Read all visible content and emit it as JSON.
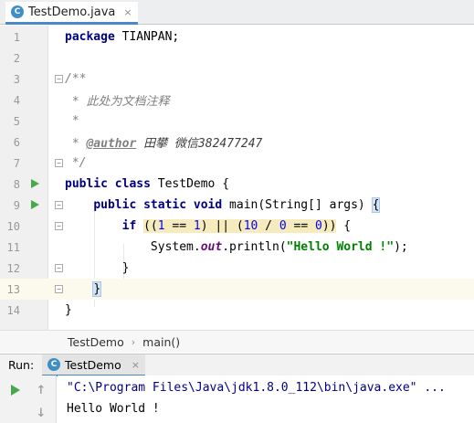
{
  "editor_tab": {
    "filename": "TestDemo.java",
    "icon": "java-class-icon",
    "close_glyph": "×"
  },
  "colors": {
    "keyword": "#000080",
    "comment": "#808080",
    "number": "#0000ff",
    "string": "#008000",
    "static_field": "#660e7a",
    "run_icon": "#49a848",
    "tab_underline": "#4a88c7",
    "current_line": "#fcfaed"
  },
  "code": {
    "line_numbers": [
      "1",
      "2",
      "3",
      "4",
      "5",
      "6",
      "7",
      "8",
      "9",
      "10",
      "11",
      "12",
      "13",
      "14"
    ],
    "l1": {
      "kw": "package",
      "rest": " TIANPAN;"
    },
    "l3": "/**",
    "l4": " * 此处为文档注释",
    "l5": " *",
    "l6": {
      "prefix": " * ",
      "tag": "@author",
      "value": " 田攀 微信382477247"
    },
    "l7": " */",
    "l8": {
      "kw1": "public",
      "kw2": " class",
      "rest": " TestDemo {"
    },
    "l9": {
      "indent": "    ",
      "kw1": "public",
      "kw2": " static",
      "kw3": " void",
      "rest": " main(String[] args) ",
      "brace": "{"
    },
    "l10": {
      "indent": "        ",
      "kw": "if",
      "sp": " ",
      "cond_open": "((",
      "n1": "1",
      "eq1": " == ",
      "n2": "1",
      "mid": ") || (",
      "n3": "10",
      "div": " / ",
      "n4": "0",
      "eq2": " == ",
      "n5": "0",
      "cond_close": "))",
      "rest": " {"
    },
    "l11": {
      "indent": "            ",
      "obj": "System.",
      "field": "out",
      "call": ".println(",
      "str": "\"Hello World !\"",
      "end": ");"
    },
    "l12": "        }",
    "l13": {
      "indent": "    ",
      "brace": "}"
    },
    "l14": "}"
  },
  "breadcrumb": {
    "items": [
      "TestDemo",
      "main()"
    ],
    "separator": "›"
  },
  "run_panel": {
    "label": "Run:",
    "tab_label": "TestDemo",
    "close_glyph": "×",
    "console": {
      "command": "\"C:\\Program Files\\Java\\jdk1.8.0_112\\bin\\java.exe\" ...",
      "output": "Hello World !"
    },
    "toolbar": {
      "rerun_icon": "rerun-icon",
      "up_icon": "up-arrow-icon",
      "down_icon": "down-arrow-icon",
      "up_glyph": "↑",
      "down_glyph": "↓"
    }
  }
}
